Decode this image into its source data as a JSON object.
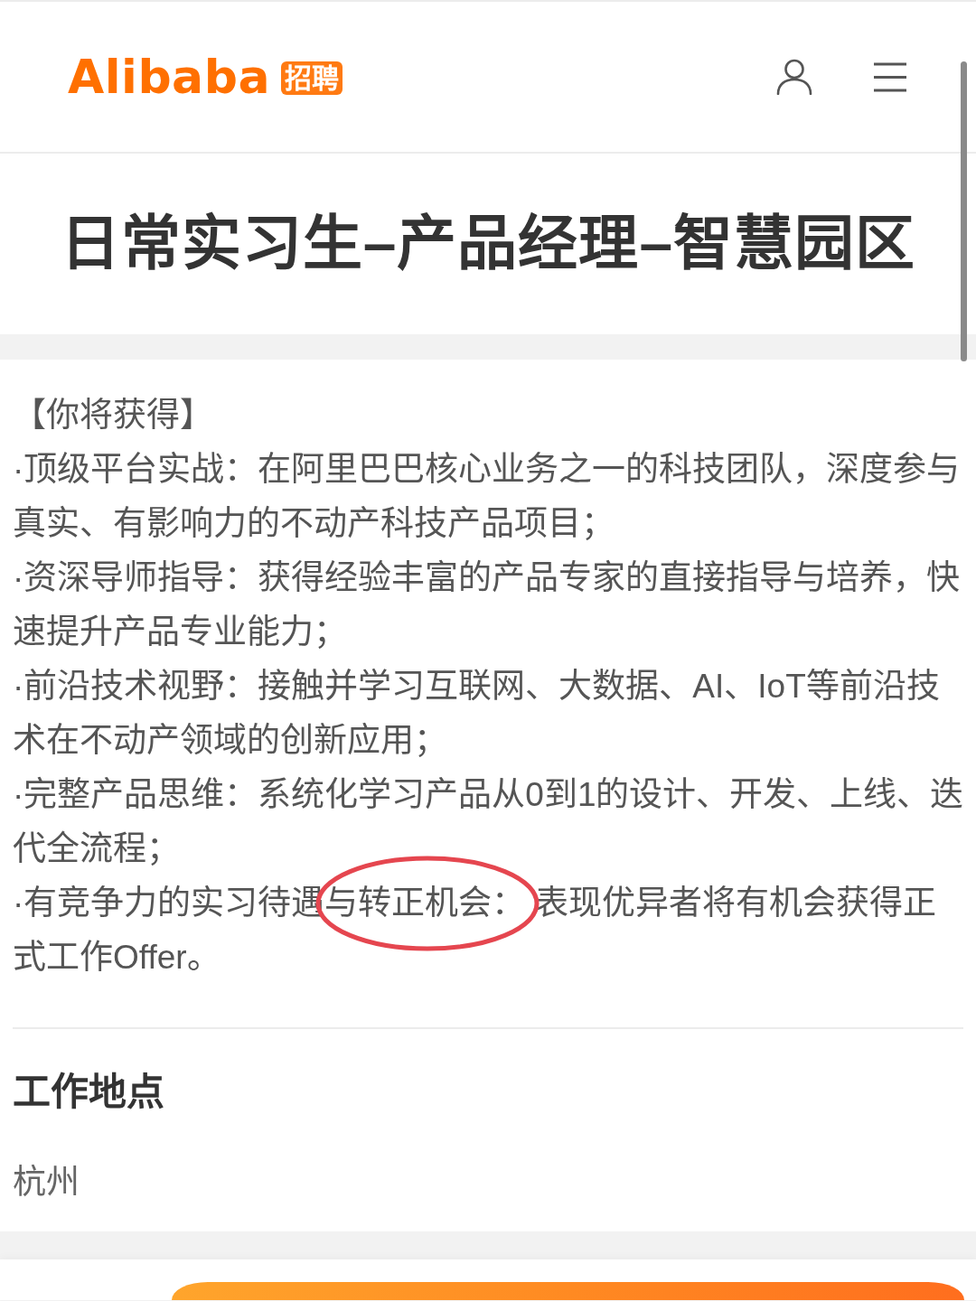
{
  "header": {
    "logo": {
      "wordmark": "Alibaba",
      "badge": "招聘"
    }
  },
  "job": {
    "title": "日常实习生–产品经理–智慧园区"
  },
  "benefits": {
    "heading": "【你将获得】",
    "items": [
      {
        "segments": [
          {
            "text": "·顶级平台实战：在阿里巴巴核心业务之一的科技团队，深度参与真实、有影响力的不动产科技产品项目；",
            "circled": false
          }
        ]
      },
      {
        "segments": [
          {
            "text": "·资深导师指导：获得经验丰富的产品专家的直接指导与培养，快速提升产品专业能力；",
            "circled": false
          }
        ]
      },
      {
        "segments": [
          {
            "text": "·前沿技术视野：接触并学习互联网、大数据、AI、IoT等前沿技术在不动产领域的创新应用；",
            "circled": false
          }
        ]
      },
      {
        "segments": [
          {
            "text": "·完整产品思维：系统化学习产品从0到1的设计、开发、上线、迭代全流程；",
            "circled": false
          }
        ]
      },
      {
        "segments": [
          {
            "text": "·有竞争力的实习待遇",
            "circled": false
          },
          {
            "text": "与转正机会：",
            "circled": true
          },
          {
            "text": " 表现优异者将有机会获得正式工作Offer。",
            "circled": false
          }
        ]
      }
    ]
  },
  "location": {
    "heading": "工作地点",
    "value": "杭州"
  }
}
